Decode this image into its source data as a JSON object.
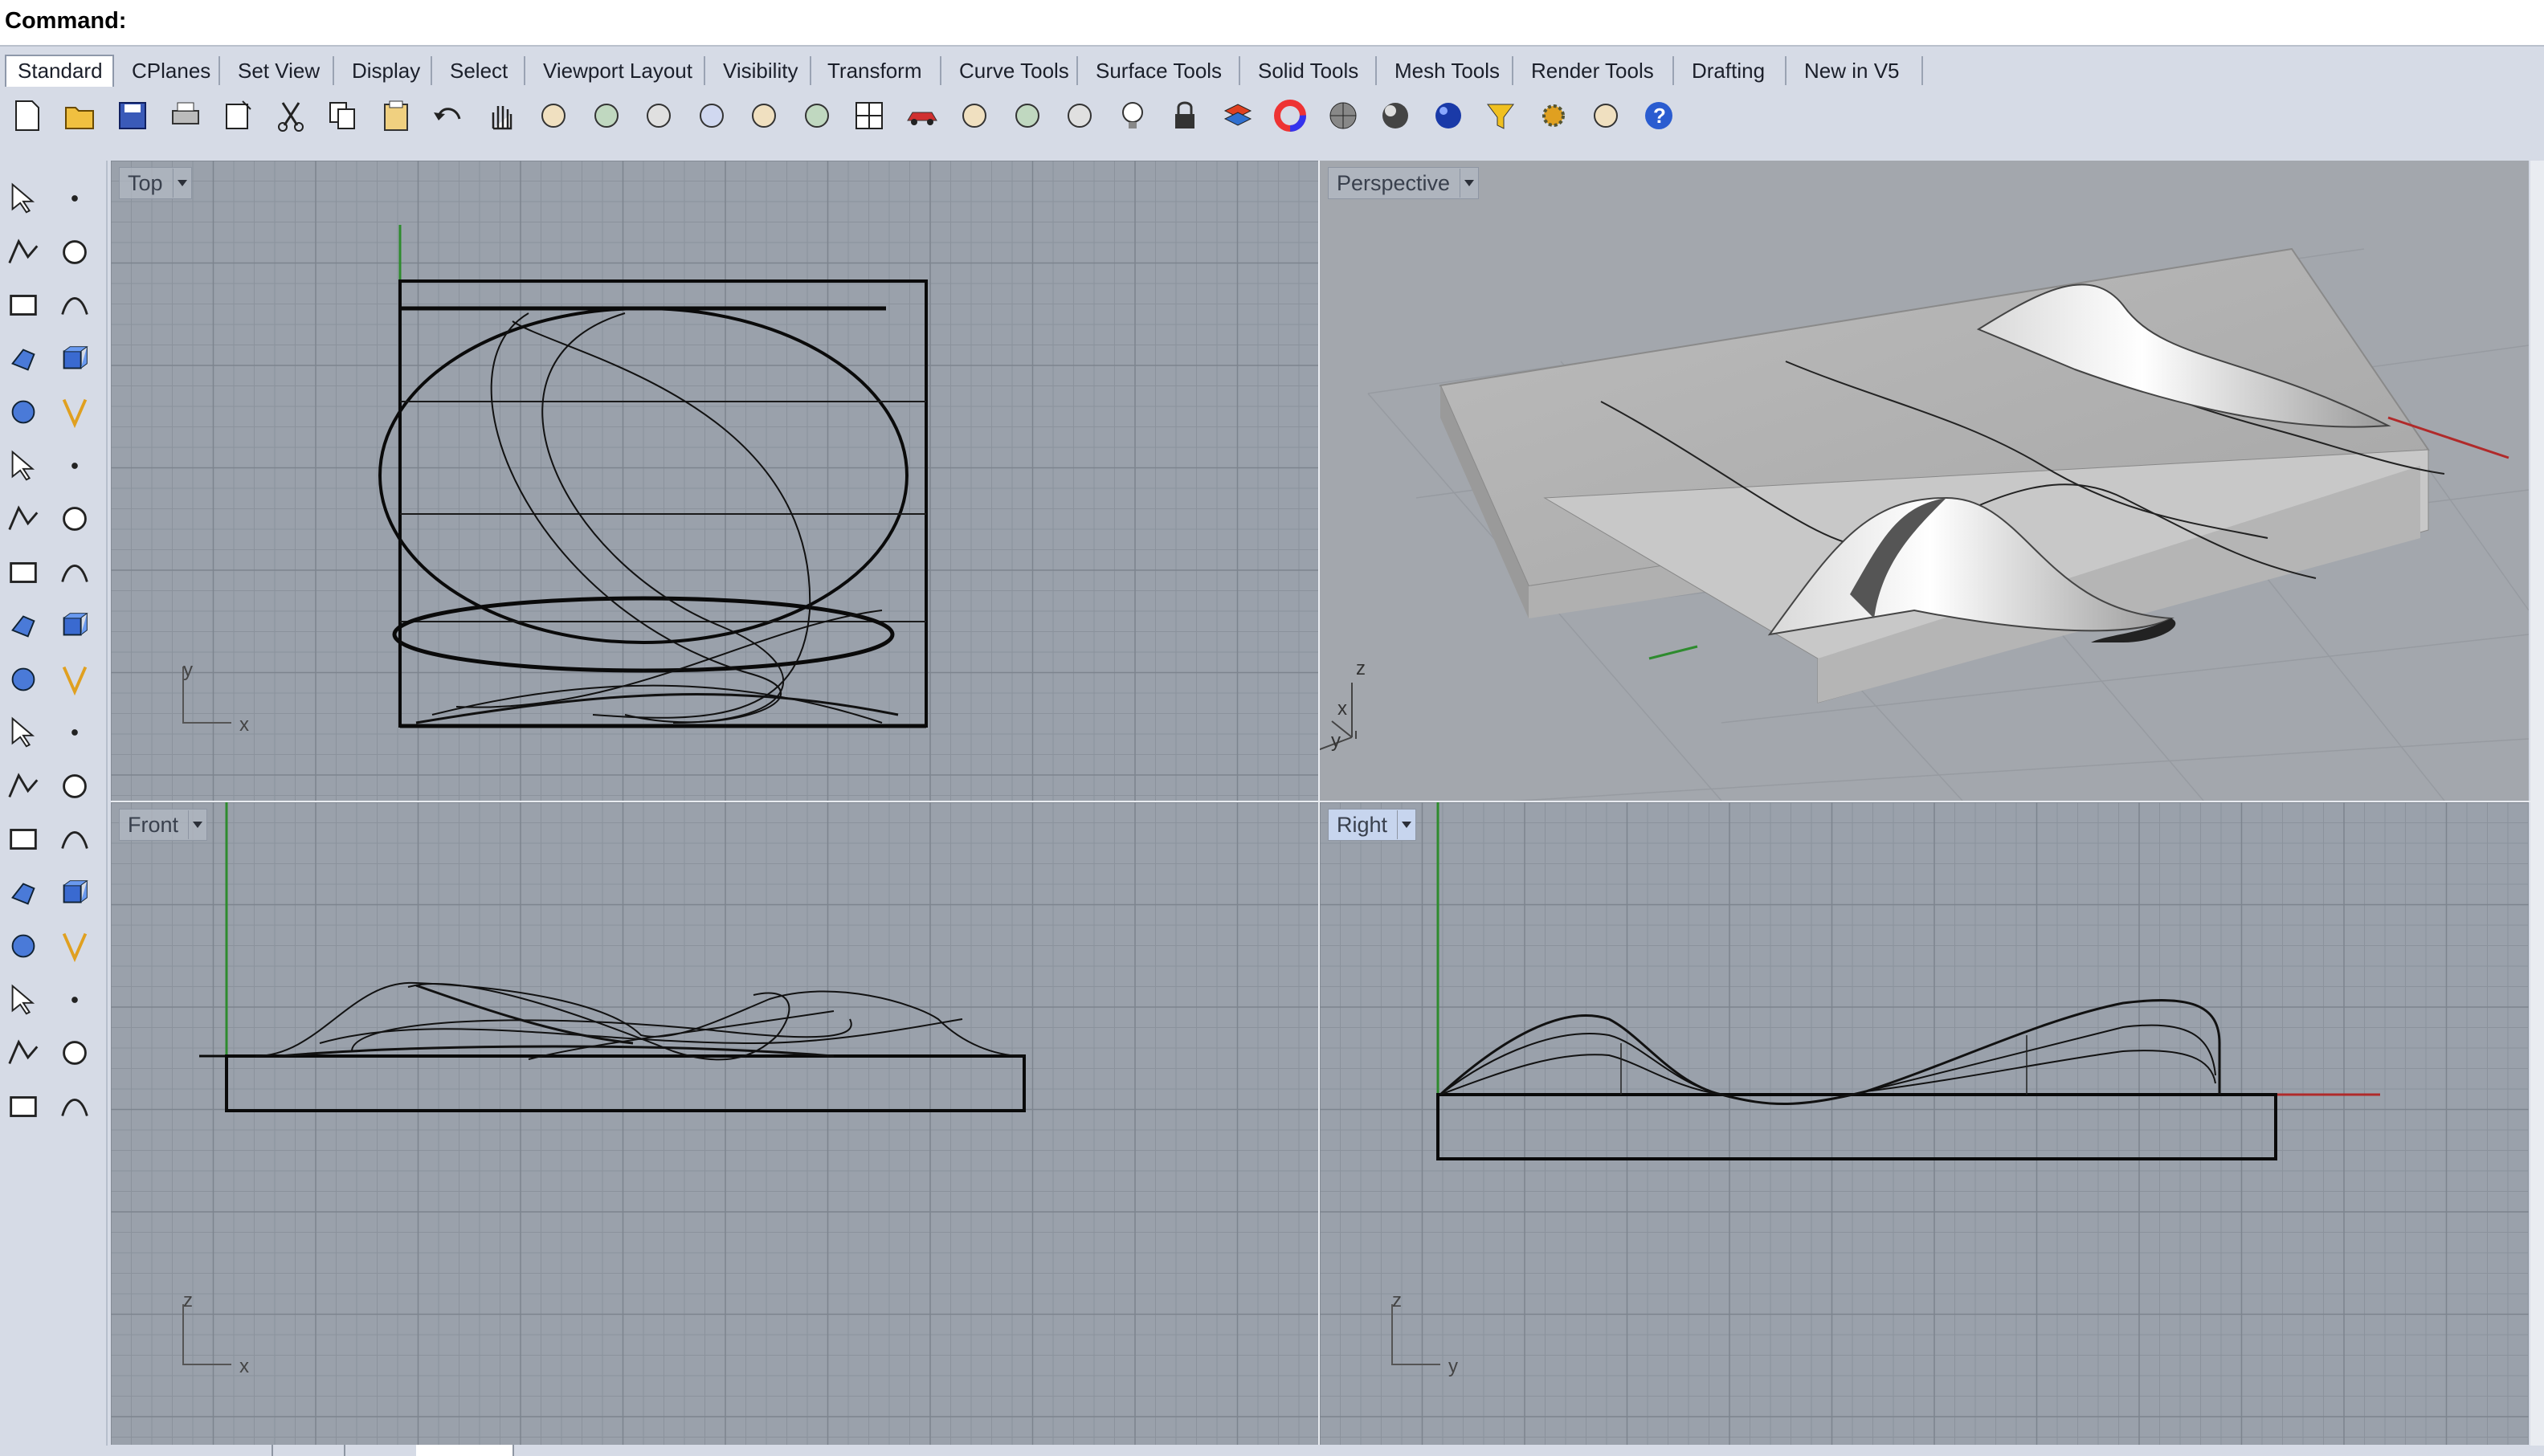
{
  "command": {
    "label": "Command:",
    "value": ""
  },
  "tabs": [
    {
      "label": "Standard",
      "active": true
    },
    {
      "label": "CPlanes"
    },
    {
      "label": "Set View"
    },
    {
      "label": "Display"
    },
    {
      "label": "Select"
    },
    {
      "label": "Viewport Layout"
    },
    {
      "label": "Visibility"
    },
    {
      "label": "Transform"
    },
    {
      "label": "Curve Tools"
    },
    {
      "label": "Surface Tools"
    },
    {
      "label": "Solid Tools"
    },
    {
      "label": "Mesh Tools"
    },
    {
      "label": "Render Tools"
    },
    {
      "label": "Drafting"
    },
    {
      "label": "New in V5"
    }
  ],
  "toolbar_icons": [
    "new-file-icon",
    "open-folder-icon",
    "save-icon",
    "print-icon",
    "import-icon",
    "cut-icon",
    "copy-icon",
    "paste-icon",
    "undo-icon",
    "pan-hand-icon",
    "move-view-icon",
    "zoom-icon",
    "zoom-window-icon",
    "zoom-extents-icon",
    "zoom-selected-icon",
    "rotate-view-icon",
    "four-viewports-icon",
    "car-render-icon",
    "shaded-icon",
    "circle-icon",
    "points-icon",
    "light-bulb-icon",
    "lock-icon",
    "layers-icon",
    "color-wheel-icon",
    "sphere-material-icon",
    "render-sphere-icon",
    "blue-sphere-icon",
    "filter-icon",
    "settings-gear-icon",
    "dimension-icon",
    "help-icon"
  ],
  "sidebar_icons": [
    "select-arrow-icon",
    "point-icon",
    "polyline-icon",
    "curve-points-icon",
    "circle-tool-icon",
    "ellipse-tool-icon",
    "arc-tool-icon",
    "rectangle-tool-icon",
    "polygon-tool-icon",
    "curve-tool-icon",
    "surface-corner-icon",
    "surface-edge-icon",
    "box-solid-icon",
    "sphere-solid-icon",
    "cylinder-icon",
    "mesh-surface-icon",
    "explode-icon",
    "split-icon",
    "trim-icon",
    "join-icon",
    "boolean-union-icon",
    "group-icon",
    "fillet-curve-icon",
    "offset-icon",
    "text-icon",
    "scale-icon",
    "array-icon",
    "mirror-icon",
    "extrude-icon",
    "dimension-tool-icon",
    "grid-array-icon",
    "move-gumball-icon",
    "analyze-icon",
    "check-icon",
    "render-box-icon",
    "material-icon"
  ],
  "viewports": {
    "top": {
      "title": "Top",
      "axis1": "y",
      "axis2": "x"
    },
    "perspective": {
      "title": "Perspective",
      "axis_z": "z",
      "axis_x": "x",
      "axis_y": "y"
    },
    "front": {
      "title": "Front",
      "axis1": "z",
      "axis2": "x"
    },
    "right": {
      "title": "Right",
      "axis1": "z",
      "axis2": "y"
    }
  },
  "colors": {
    "grid_bg": "#9aa1ab",
    "grid_line": "#8b929c",
    "grid_major": "#7d848e",
    "axis_green": "#2e8b2e",
    "axis_red": "#b02a2a",
    "active_title": "#c7d5ee"
  }
}
